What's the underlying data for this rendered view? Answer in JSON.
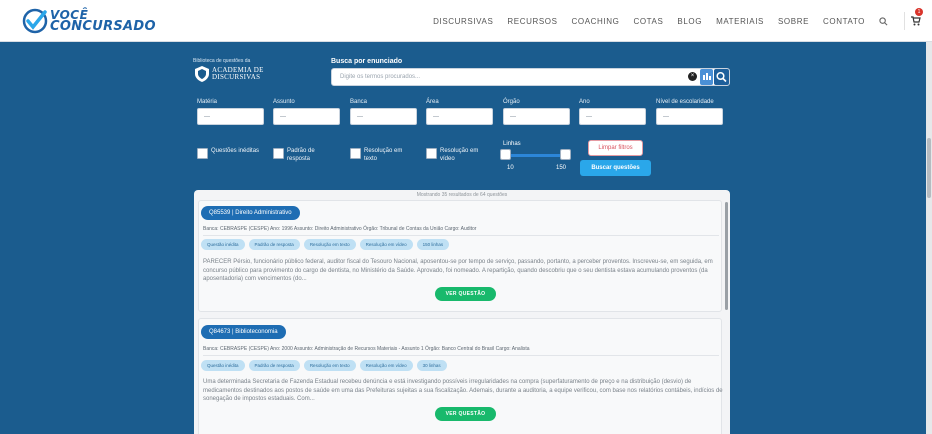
{
  "topbar": {
    "logo_line1": "VOCÊ",
    "logo_line2": "CONCURSADO",
    "nav": [
      "DISCURSIVAS",
      "RECURSOS",
      "COACHING",
      "COTAS",
      "BLOG",
      "MATERIAIS",
      "SOBRE",
      "CONTATO"
    ],
    "cart_count": "1",
    "icons": [
      "search-icon",
      "cart-icon"
    ]
  },
  "library": {
    "label": "Biblioteca de questões da",
    "brand_line1": "ACADEMIA DE",
    "brand_line2": "DISCURSIVAS"
  },
  "search": {
    "label": "Busca por enunciado",
    "placeholder": "Digite os termos procurados..."
  },
  "filters": {
    "labels": [
      "Matéria",
      "Assunto",
      "Banca",
      "Área",
      "Órgão",
      "Ano",
      "Nível de escolaridade"
    ]
  },
  "checkboxes": [
    "Questões inéditas",
    "Padrão de resposta",
    "Resolução em texto",
    "Resolução em vídeo"
  ],
  "slider": {
    "label": "Linhas",
    "min": "10",
    "max": "150"
  },
  "buttons": {
    "clear": "Limpar filtros",
    "search": "Buscar questões"
  },
  "results": {
    "header": "Mostrando 35 resultados de 64 questões",
    "questions": [
      {
        "tag": "Q85539  |  Direito Administrativo",
        "meta": "Banca: CEBRASPE (CESPE)   Ano: 1996   Assunto: Direito Administrativo   Órgão: Tribunal de Contas da União   Cargo: Auditor",
        "chips": [
          "Questão inédita",
          "Padrão de resposta",
          "Resolução em texto",
          "Resolução em vídeo",
          "150 linhas"
        ],
        "text": "PARECER Pérsio, funcionário público federal, auditor fiscal do Tesouro Nacional, aposentou-se por tempo de serviço, passando, portanto, a perceber proventos. Inscreveu-se, em seguida, em concurso público para provimento do cargo de dentista, no Ministério da Saúde. Aprovado, foi nomeado. A repartição, quando descobriu que o seu dentista estava acumulando proventos (da aposentadoria) com vencimentos (do...",
        "button": "VER QUESTÃO"
      },
      {
        "tag": "Q84673  |  Biblioteconomia",
        "meta": "Banca: CEBRASPE (CESPE)   Ano: 2000   Assunto: Administração de Recursos Materiais - Assunto 1   Órgão: Banco Central do Brasil   Cargo: Analista",
        "chips": [
          "Questão inédita",
          "Padrão de resposta",
          "Resolução em texto",
          "Resolução em vídeo",
          "30 linhas"
        ],
        "text": "Uma determinada Secretaria de Fazenda Estadual recebeu denúncia e está investigando possíveis irregularidades na compra (superfaturamento de preço e na distribuição (desvio) de medicamentos destinados aos postos de saúde em uma das Prefeituras sujeitas a sua fiscalização. Ademais, durante a auditoria, a equipe verificou, com base nos relatórios contábeis, indícios de sonegação de impostos estaduais. Com...",
        "button": "VER QUESTÃO"
      }
    ]
  },
  "colors": {
    "background": "#1b5c8e",
    "tag": "#1e6db3",
    "chip": "#bfe0f4",
    "action_green": "#18b96c",
    "search_blue": "#2aa7ea"
  }
}
